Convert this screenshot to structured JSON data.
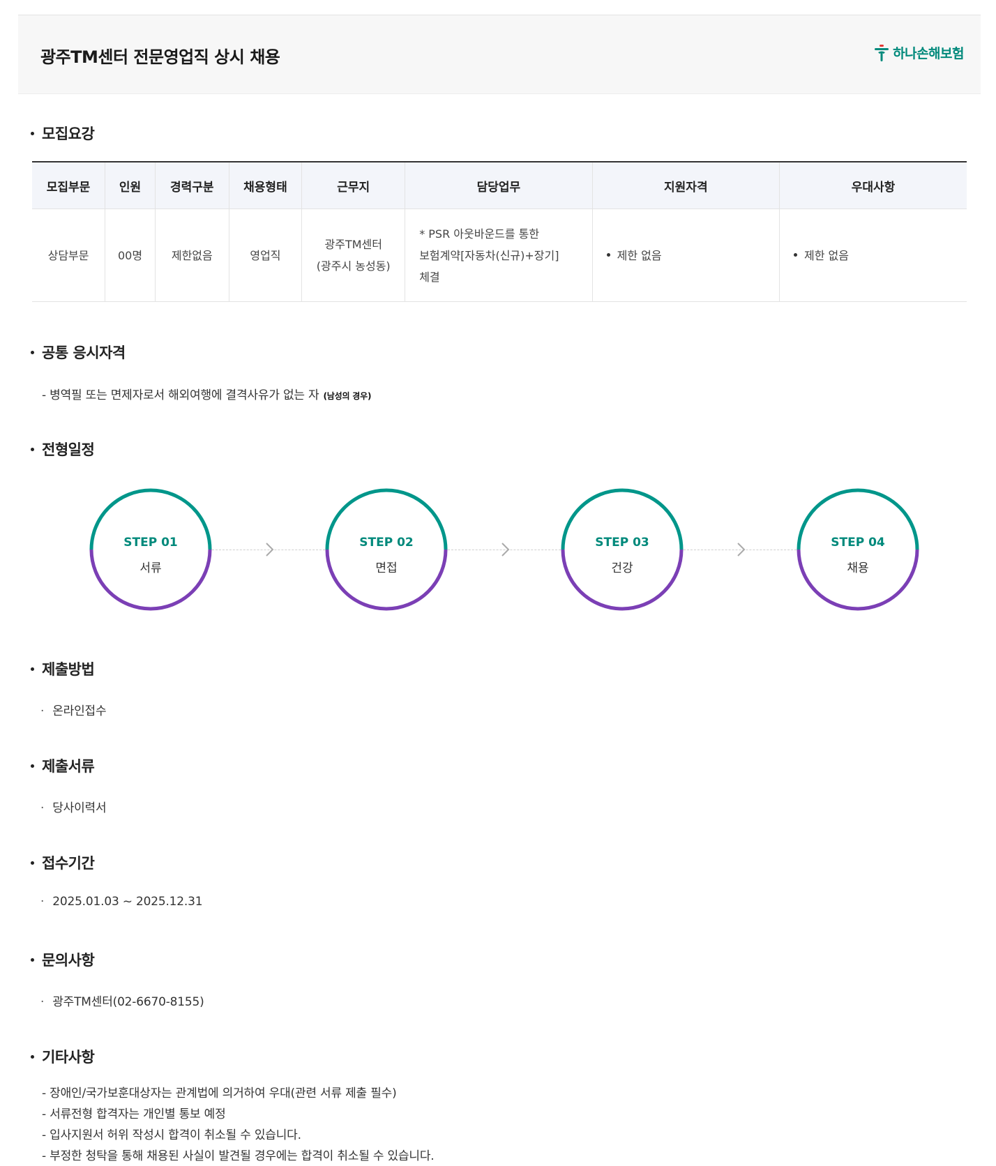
{
  "header": {
    "title": "광주TM센터 전문영업직 상시 채용",
    "logo_text": "하나손해보험",
    "brand_color": "#00897b"
  },
  "sections": {
    "recruit": "모집요강",
    "qualification": "공통 응시자격",
    "schedule": "전형일정",
    "method": "제출방법",
    "documents": "제출서류",
    "period": "접수기간",
    "inquiry": "문의사항",
    "etc": "기타사항"
  },
  "table": {
    "headers": [
      "모집부문",
      "인원",
      "경력구분",
      "채용형태",
      "근무지",
      "담당업무",
      "지원자격",
      "우대사항"
    ],
    "row": {
      "department": "상담부문",
      "headcount": "00명",
      "career": "제한없음",
      "type": "영업직",
      "location_line1": "광주TM센터",
      "location_line2": "(광주시 농성동)",
      "duty_line1": "* PSR 아웃바운드를 통한",
      "duty_line2": "보험계약[자동차(신규)+장기]",
      "duty_line3": "체결",
      "qualification": "제한 없음",
      "preference": "제한 없음"
    }
  },
  "qualification": {
    "text": "- 병역필 또는 면제자로서 해외여행에 결격사유가 없는 자",
    "note": "(남성의 경우)"
  },
  "steps": [
    {
      "label": "STEP 01",
      "name": "서류"
    },
    {
      "label": "STEP 02",
      "name": "면접"
    },
    {
      "label": "STEP 03",
      "name": "건강"
    },
    {
      "label": "STEP 04",
      "name": "채용"
    }
  ],
  "step_colors": {
    "top": "#00968a",
    "bottom": "#7b3fb5"
  },
  "method": {
    "bullet": "·",
    "text": "온라인접수"
  },
  "documents": {
    "bullet": "·",
    "text": "당사이력서"
  },
  "period": {
    "bullet": "·",
    "text": "2025.01.03 ~ 2025.12.31"
  },
  "inquiry": {
    "bullet": "·",
    "text": "광주TM센터(02-6670-8155)"
  },
  "etc": [
    "- 장애인/국가보훈대상자는 관계법에 의거하여 우대(관련 서류 제출 필수)",
    "- 서류전형 합격자는 개인별 통보 예정",
    "- 입사지원서 허위 작성시 합격이 취소될 수 있습니다.",
    "- 부정한 청탁을 통해 채용된 사실이 발견될 경우에는 합격이 취소될 수 있습니다."
  ]
}
